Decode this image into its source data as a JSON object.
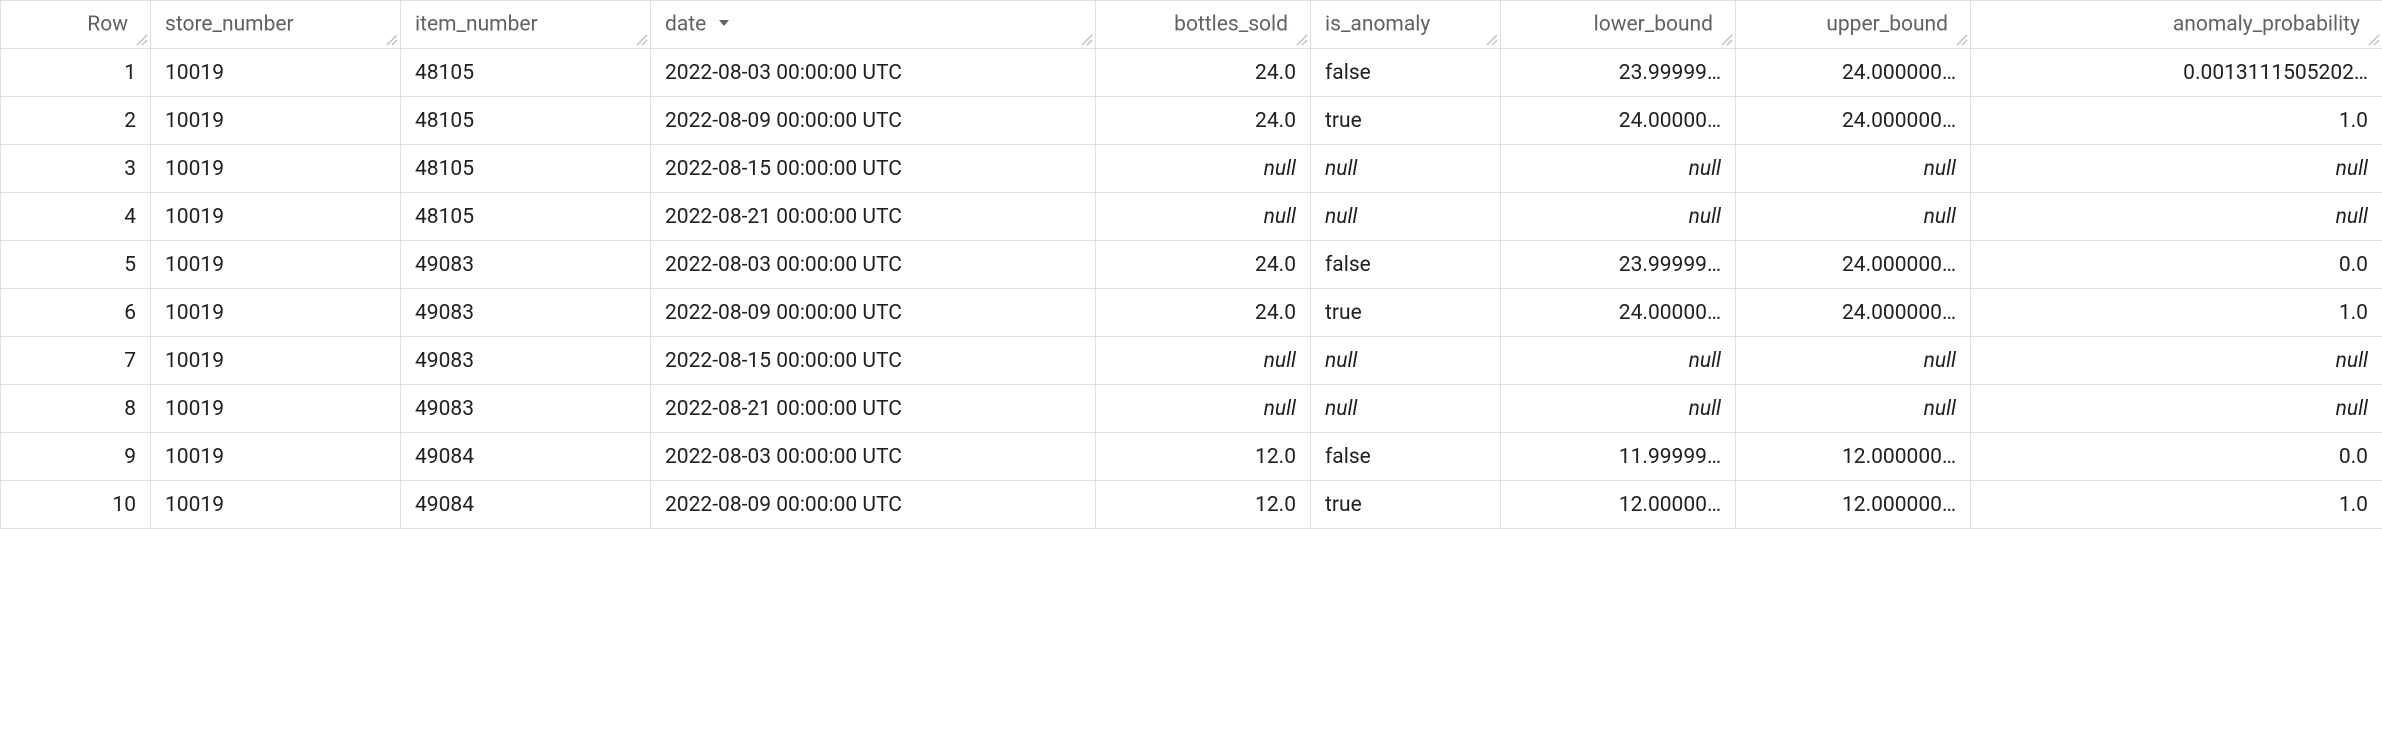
{
  "null_label": "null",
  "sorted_column_index": 3,
  "sort_direction": "desc",
  "columns": [
    {
      "key": "row",
      "label": "Row",
      "align": "num",
      "sortable": false
    },
    {
      "key": "store_number",
      "label": "store_number",
      "align": "left",
      "sortable": true
    },
    {
      "key": "item_number",
      "label": "item_number",
      "align": "left",
      "sortable": true
    },
    {
      "key": "date",
      "label": "date",
      "align": "left",
      "sortable": true
    },
    {
      "key": "bottles_sold",
      "label": "bottles_sold",
      "align": "num",
      "sortable": true
    },
    {
      "key": "is_anomaly",
      "label": "is_anomaly",
      "align": "left",
      "sortable": true
    },
    {
      "key": "lower_bound",
      "label": "lower_bound",
      "align": "num",
      "sortable": true
    },
    {
      "key": "upper_bound",
      "label": "upper_bound",
      "align": "num",
      "sortable": true
    },
    {
      "key": "anomaly_probability",
      "label": "anomaly_probability",
      "align": "num",
      "sortable": true
    }
  ],
  "rows": [
    {
      "row": "1",
      "store_number": "10019",
      "item_number": "48105",
      "date": "2022-08-03 00:00:00 UTC",
      "bottles_sold": "24.0",
      "is_anomaly": "false",
      "lower_bound": "23.99999…",
      "upper_bound": "24.000000…",
      "anomaly_probability": "0.0013111505202…"
    },
    {
      "row": "2",
      "store_number": "10019",
      "item_number": "48105",
      "date": "2022-08-09 00:00:00 UTC",
      "bottles_sold": "24.0",
      "is_anomaly": "true",
      "lower_bound": "24.00000…",
      "upper_bound": "24.000000…",
      "anomaly_probability": "1.0"
    },
    {
      "row": "3",
      "store_number": "10019",
      "item_number": "48105",
      "date": "2022-08-15 00:00:00 UTC",
      "bottles_sold": null,
      "is_anomaly": null,
      "lower_bound": null,
      "upper_bound": null,
      "anomaly_probability": null
    },
    {
      "row": "4",
      "store_number": "10019",
      "item_number": "48105",
      "date": "2022-08-21 00:00:00 UTC",
      "bottles_sold": null,
      "is_anomaly": null,
      "lower_bound": null,
      "upper_bound": null,
      "anomaly_probability": null
    },
    {
      "row": "5",
      "store_number": "10019",
      "item_number": "49083",
      "date": "2022-08-03 00:00:00 UTC",
      "bottles_sold": "24.0",
      "is_anomaly": "false",
      "lower_bound": "23.99999…",
      "upper_bound": "24.000000…",
      "anomaly_probability": "0.0"
    },
    {
      "row": "6",
      "store_number": "10019",
      "item_number": "49083",
      "date": "2022-08-09 00:00:00 UTC",
      "bottles_sold": "24.0",
      "is_anomaly": "true",
      "lower_bound": "24.00000…",
      "upper_bound": "24.000000…",
      "anomaly_probability": "1.0"
    },
    {
      "row": "7",
      "store_number": "10019",
      "item_number": "49083",
      "date": "2022-08-15 00:00:00 UTC",
      "bottles_sold": null,
      "is_anomaly": null,
      "lower_bound": null,
      "upper_bound": null,
      "anomaly_probability": null
    },
    {
      "row": "8",
      "store_number": "10019",
      "item_number": "49083",
      "date": "2022-08-21 00:00:00 UTC",
      "bottles_sold": null,
      "is_anomaly": null,
      "lower_bound": null,
      "upper_bound": null,
      "anomaly_probability": null
    },
    {
      "row": "9",
      "store_number": "10019",
      "item_number": "49084",
      "date": "2022-08-03 00:00:00 UTC",
      "bottles_sold": "12.0",
      "is_anomaly": "false",
      "lower_bound": "11.99999…",
      "upper_bound": "12.000000…",
      "anomaly_probability": "0.0"
    },
    {
      "row": "10",
      "store_number": "10019",
      "item_number": "49084",
      "date": "2022-08-09 00:00:00 UTC",
      "bottles_sold": "12.0",
      "is_anomaly": "true",
      "lower_bound": "12.00000…",
      "upper_bound": "12.000000…",
      "anomaly_probability": "1.0"
    }
  ]
}
